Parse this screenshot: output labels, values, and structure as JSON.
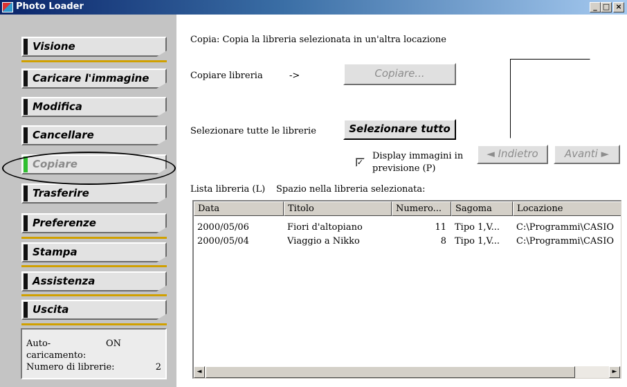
{
  "window": {
    "title": "Photo Loader",
    "minimize": "_",
    "maximize": "□",
    "close": "×"
  },
  "menu": [
    {
      "label": "Visione",
      "active": false
    },
    {
      "label": "Caricare l'immagine",
      "active": false
    },
    {
      "label": "Modifica",
      "active": false
    },
    {
      "label": "Cancellare",
      "active": false
    },
    {
      "label": "Copiare",
      "active": true
    },
    {
      "label": "Trasferire",
      "active": false
    },
    {
      "label": "Preferenze",
      "active": false
    },
    {
      "label": "Stampa",
      "active": false
    },
    {
      "label": "Assistenza",
      "active": false
    },
    {
      "label": "Uscita",
      "active": false
    }
  ],
  "status": {
    "autoload_label": "Auto-caricamento:",
    "autoload_value": "ON",
    "libcount_label": "Numero di librerie:",
    "libcount_value": "2"
  },
  "main": {
    "description": "Copia: Copia la libreria selezionata in un'altra locazione",
    "copy_library_label": "Copiare libreria",
    "arrow": "->",
    "copy_button": "Copiare...",
    "select_all_label": "Selezionare tutte le librerie",
    "select_all_button": "Selezionare tutto",
    "preview_checkbox_line1": "Display immagini in",
    "preview_checkbox_line2": "previsione (P)",
    "preview_checked": true,
    "back_button": "◄ Indietro",
    "next_button": "Avanti ►",
    "list_label": "Lista libreria (L)",
    "space_label": "Spazio nella libreria selezionata:"
  },
  "table": {
    "columns": [
      "Data",
      "Titolo",
      "Numero...",
      "Sagoma",
      "Locazione"
    ],
    "rows": [
      [
        "2000/05/06",
        "Fiori d'altopiano",
        "11",
        "Tipo 1,V...",
        "C:\\Programmi\\CASIO"
      ],
      [
        "2000/05/04",
        "Viaggio a Nikko",
        "8",
        "Tipo 1,V...",
        "C:\\Programmi\\CASIO"
      ]
    ],
    "scroll_left": "◄",
    "scroll_right": "►"
  }
}
